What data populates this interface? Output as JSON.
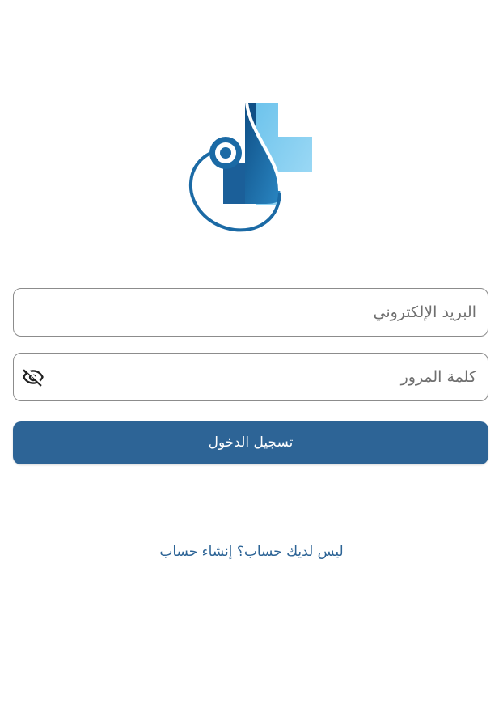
{
  "app": {
    "logo_icon": "medical-cross-stethoscope-logo-icon"
  },
  "login_form": {
    "email_placeholder": "البريد الإلكتروني",
    "password_placeholder": "كلمة المرور",
    "password_visibility_icon": "eye-off-icon",
    "submit_label": "تسجيل الدخول"
  },
  "footer": {
    "register_link": "ليس لديك حساب؟ إنشاء حساب"
  },
  "colors": {
    "primary": "#2d6496",
    "logo_dark_blue": "#1a6aa8",
    "logo_light_blue": "#87cef0",
    "field_border": "#8c8c8c",
    "placeholder": "#6f6f6f"
  }
}
